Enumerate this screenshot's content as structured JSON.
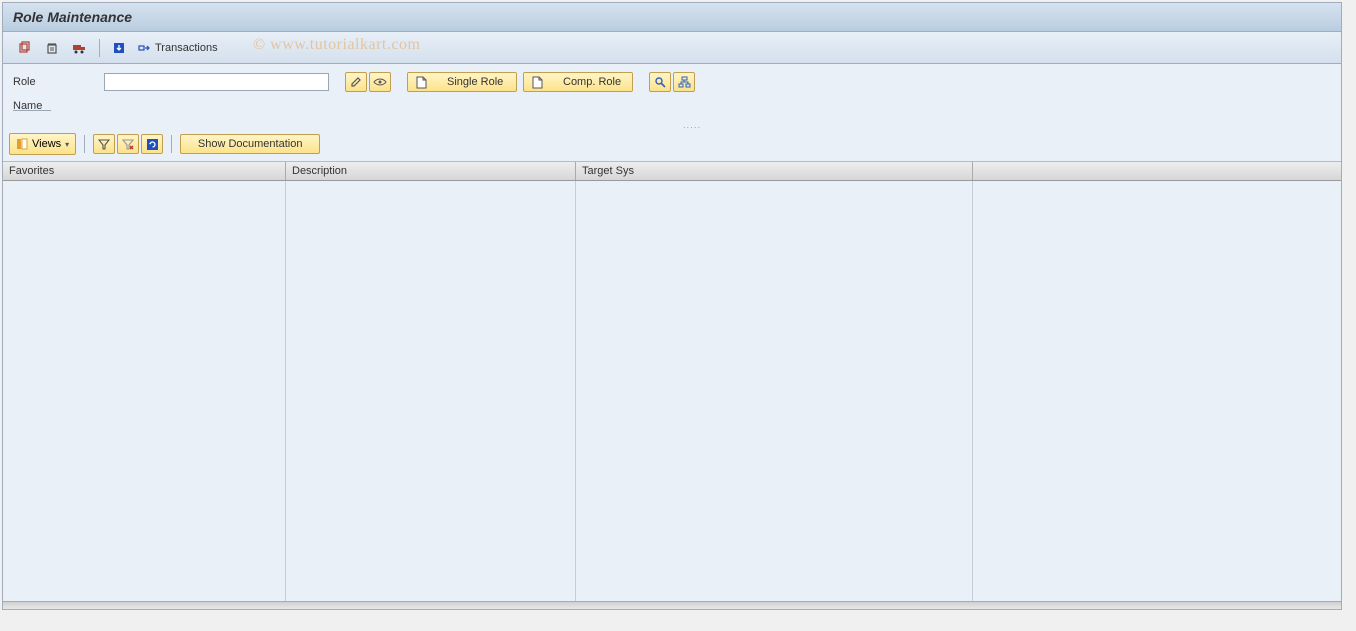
{
  "title": "Role Maintenance",
  "toolbar": {
    "transactions_label": "Transactions"
  },
  "watermark": "© www.tutorialkart.com",
  "form": {
    "role_label": "Role",
    "role_value": "",
    "name_label": "Name",
    "single_role_label": "Single Role",
    "comp_role_label": "Comp. Role"
  },
  "grid_toolbar": {
    "views_label": "Views",
    "show_doc_label": "Show Documentation"
  },
  "grid": {
    "columns": {
      "favorites": "Favorites",
      "description": "Description",
      "target_sys": "Target Sys"
    }
  }
}
